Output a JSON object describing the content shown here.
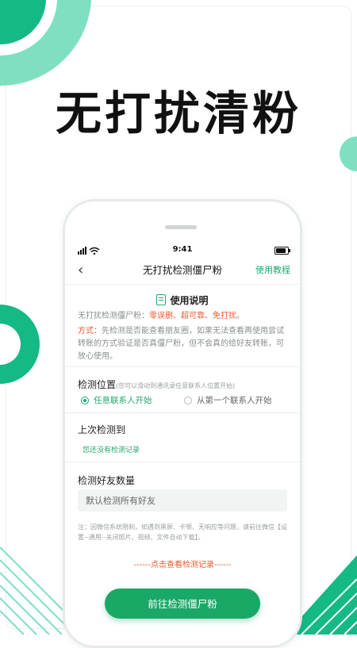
{
  "headline": "无打扰清粉",
  "colors": {
    "accent": "#1aa866",
    "warning": "#e85a2c",
    "deco_mint": "#7ee0c0"
  },
  "status_bar": {
    "time": "9:41"
  },
  "navbar": {
    "title": "无打扰检测僵尸粉",
    "help_link": "使用教程",
    "back_icon": "chevron-left-icon"
  },
  "instructions": {
    "title": "使用说明",
    "line1_prefix": "无打扰检测僵尸粉：",
    "line1_highlight": "零误删、超可靠、免打扰",
    "line1_suffix": "。",
    "method_label": "方式：",
    "method_text": "先检测是否能查看朋友圈，如果无法查看再使用尝试转账的方式验证是否真僵尸粉，但不会真的给好友转账，可放心使用。"
  },
  "detect_position": {
    "label": "检测位置",
    "hint": "(您可以滑动到通讯录任意联系人位置开始)",
    "options": [
      {
        "label": "任意联系人开始",
        "selected": true
      },
      {
        "label": "从第一个联系人开始",
        "selected": false
      }
    ]
  },
  "last_detect": {
    "label": "上次检测到",
    "value": "您还没有检测记录"
  },
  "friend_count": {
    "label": "检测好友数量",
    "placeholder": "默认检测所有好友"
  },
  "note": "注：因微信系统限制，如遇到黑屏、卡顿、无响应等问题，请前往微信【设置--通用--关闭照片、视频、文件自动下载】。",
  "record_link": "------点击查看检测记录------",
  "cta_button": "前往检测僵尸粉"
}
